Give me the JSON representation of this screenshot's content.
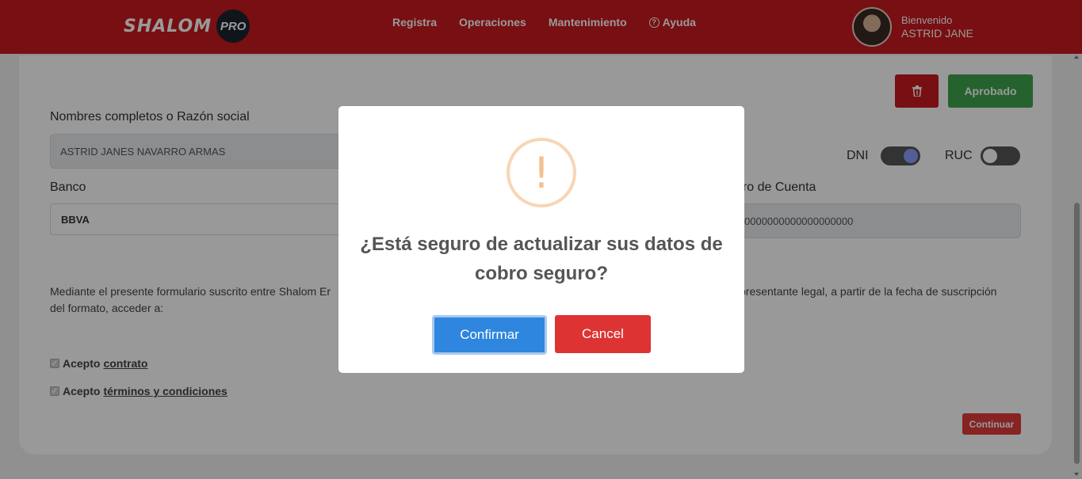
{
  "header": {
    "logo_text": "SHALOM",
    "logo_badge": "PRO",
    "nav": [
      {
        "label": "Registra"
      },
      {
        "label": "Operaciones"
      },
      {
        "label": "Mantenimiento"
      },
      {
        "label": "Ayuda"
      }
    ],
    "user": {
      "greeting": "Bienvenido",
      "name": "ASTRID JANE"
    }
  },
  "form": {
    "approved_label": "Aprobado",
    "name_label": "Nombres completos o Razón social",
    "name_value": "ASTRID JANES NAVARRO ARMAS",
    "dni_label": "DNI",
    "ruc_label": "RUC",
    "dni_on": true,
    "ruc_on": false,
    "bank_label": "Banco",
    "bank_value": "BBVA",
    "account_label": "ero de Cuenta",
    "account_value": "0000000000000000000",
    "paragraph_left": "Mediante el presente formulario suscrito entre Shalom Er",
    "paragraph_right": "presentante legal, a partir de la fecha de suscripción",
    "paragraph_line2": "del formato, acceder a:",
    "accept_prefix": "Acepto",
    "contract_link": "contrato",
    "terms_link": "términos y condiciones",
    "continue_label": "Continuar"
  },
  "modal": {
    "icon": "!",
    "title": "¿Está seguro de actualizar sus datos de cobro seguro?",
    "confirm_label": "Confirmar",
    "cancel_label": "Cancel"
  },
  "colors": {
    "brand_red": "#c8191e",
    "approve_green": "#3fa34d",
    "confirm_blue": "#2e86de",
    "cancel_red": "#dd3333"
  }
}
